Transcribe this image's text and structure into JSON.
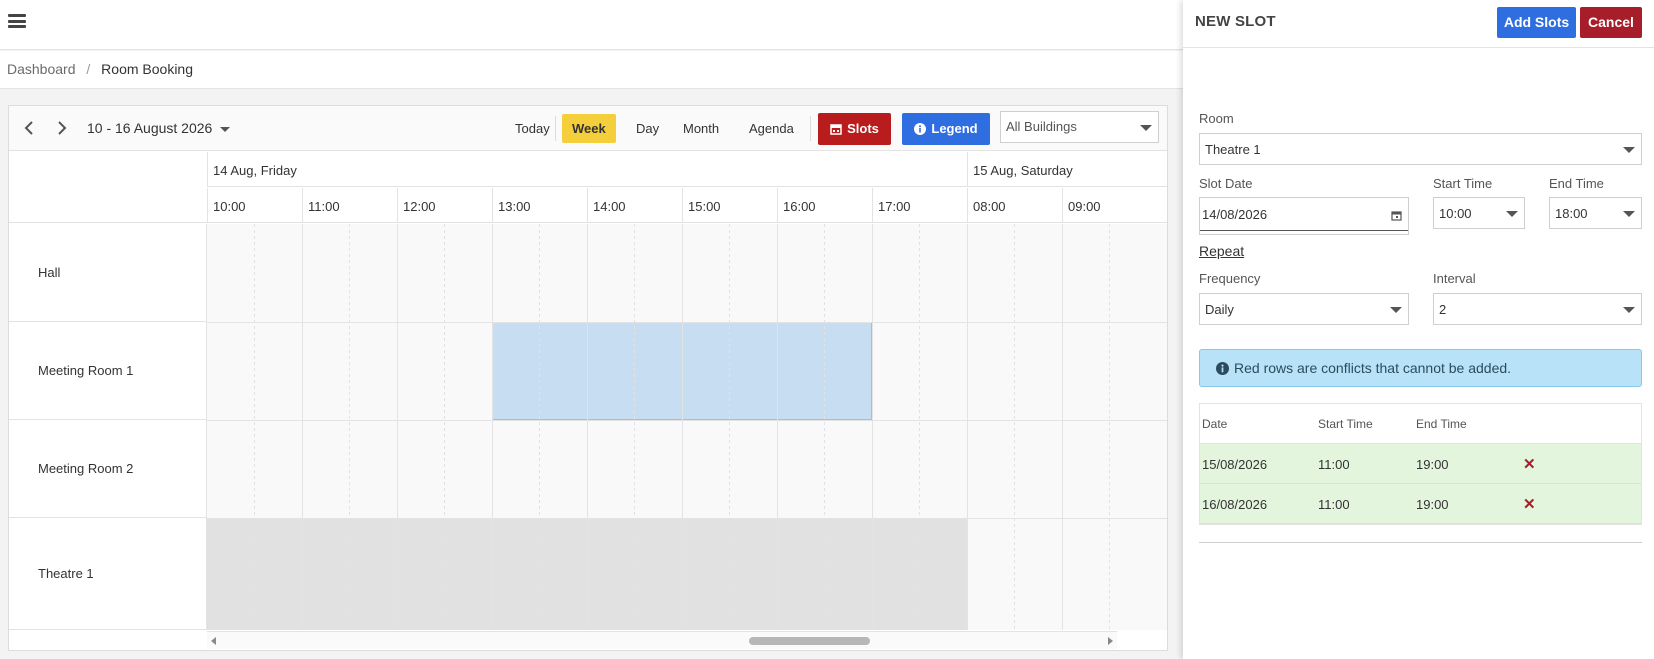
{
  "breadcrumb": {
    "home": "Dashboard",
    "separator": "/",
    "current": "Room Booking"
  },
  "scheduler": {
    "date_range": "10 - 16 August 2026",
    "views": {
      "today": "Today",
      "week": "Week",
      "day": "Day",
      "month": "Month",
      "agenda": "Agenda"
    },
    "active_view": "Week",
    "slots_label": "Slots",
    "legend_label": "Legend",
    "building_filter": "All Buildings",
    "days": [
      "14 Aug, Friday",
      "15 Aug, Saturday"
    ],
    "times": [
      "10:00",
      "11:00",
      "12:00",
      "13:00",
      "14:00",
      "15:00",
      "16:00",
      "17:00",
      "08:00",
      "09:00"
    ],
    "resources": [
      "Hall",
      "Meeting Room 1",
      "Meeting Room 2",
      "Theatre 1"
    ],
    "colors": {
      "selection": "#c6ddf2",
      "blocked": "#e1e1e1",
      "active_view": "#f5cf3b"
    }
  },
  "panel": {
    "title": "NEW SLOT",
    "add_label": "Add Slots",
    "cancel_label": "Cancel",
    "room_label": "Room",
    "room_value": "Theatre 1",
    "slot_date_label": "Slot Date",
    "slot_date_value": "14/08/2026",
    "start_time_label": "Start Time",
    "start_time_value": "10:00",
    "end_time_label": "End Time",
    "end_time_value": "18:00",
    "repeat_label": "Repeat",
    "frequency_label": "Frequency",
    "frequency_value": "Daily",
    "interval_label": "Interval",
    "interval_value": "2",
    "info_text": "Red rows are conflicts that cannot be added.",
    "table": {
      "headers": {
        "date": "Date",
        "start": "Start Time",
        "end": "End Time"
      },
      "rows": [
        {
          "date": "15/08/2026",
          "start": "11:00",
          "end": "19:00"
        },
        {
          "date": "16/08/2026",
          "start": "11:00",
          "end": "19:00"
        }
      ]
    }
  }
}
